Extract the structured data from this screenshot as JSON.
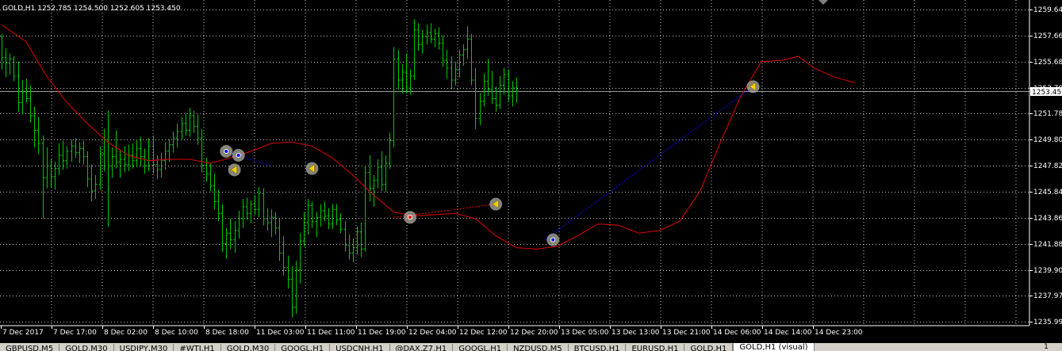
{
  "header": {
    "text": "GOLD,H1  1252.785 1254.500 1252.605 1253.450"
  },
  "current_price_label": "1253.450",
  "price_axis_labels": [
    "1259.645",
    "1257.665",
    "1255.685",
    "1253.705",
    "1251.780",
    "1249.800",
    "1247.820",
    "1245.840",
    "1243.860",
    "1241.880",
    "1239.900",
    "1237.975",
    "1235.995"
  ],
  "time_axis_labels": [
    "7 Dec 2017",
    "7 Dec 17:00",
    "8 Dec 02:00",
    "8 Dec 10:00",
    "8 Dec 18:00",
    "11 Dec 03:00",
    "11 Dec 11:00",
    "11 Dec 19:00",
    "12 Dec 04:00",
    "12 Dec 12:00",
    "12 Dec 20:00",
    "13 Dec 05:00",
    "13 Dec 13:00",
    "13 Dec 21:00",
    "14 Dec 06:00",
    "14 Dec 14:00",
    "14 Dec 23:00"
  ],
  "colors": {
    "bars": "#00c800",
    "ma": "#e00000",
    "grid": "#bfbfbf",
    "trade_buy": "#0000ff",
    "trade_sell": "#ff0000",
    "marker_ring": "#b0b0a0"
  },
  "tabs": [
    "GBPUSD,M5",
    "GOLD,M30",
    "USDJPY,M30",
    "#WTI,H1",
    "GOLD,M30",
    "GOOGL,H1",
    "USDCNH,H1",
    "@DAX.Z7,H1",
    "GOOGL,H1",
    "NZDUSD,M5",
    "BTCUSD,H1",
    "EURUSD,H1",
    "GOLD,H1",
    "GOLD,H1 (visual)"
  ],
  "active_tab": "GOLD,H1 (visual)",
  "tab_nav": "1",
  "chart_data": {
    "type": "bar",
    "style": "ohlc",
    "symbol": "GOLD",
    "timeframe": "H1",
    "ylim": [
      1235.995,
      1259.645
    ],
    "current_price": 1253.45,
    "grid": true,
    "ohlc": [
      [
        1257.6,
        1257.8,
        1255.1,
        1256.0
      ],
      [
        1256.0,
        1256.7,
        1254.5,
        1255.6
      ],
      [
        1255.6,
        1256.3,
        1254.7,
        1255.9
      ],
      [
        1255.9,
        1256.1,
        1254.2,
        1254.6
      ],
      [
        1254.6,
        1255.7,
        1251.9,
        1252.6
      ],
      [
        1252.6,
        1254.3,
        1251.7,
        1253.4
      ],
      [
        1253.4,
        1254.4,
        1252.6,
        1252.9
      ],
      [
        1252.9,
        1253.9,
        1251.1,
        1251.6
      ],
      [
        1251.6,
        1252.3,
        1249.2,
        1250.5
      ],
      [
        1250.5,
        1251.5,
        1248.7,
        1249.5
      ],
      [
        1249.5,
        1250.1,
        1243.8,
        1246.9
      ],
      [
        1246.9,
        1249.2,
        1246.1,
        1247.8
      ],
      [
        1247.8,
        1248.3,
        1246.2,
        1247.0
      ],
      [
        1247.0,
        1248.1,
        1246.0,
        1247.6
      ],
      [
        1247.6,
        1249.5,
        1247.1,
        1248.6
      ],
      [
        1248.6,
        1249.7,
        1247.5,
        1248.2
      ],
      [
        1248.2,
        1249.3,
        1247.6,
        1248.9
      ],
      [
        1248.9,
        1249.8,
        1248.1,
        1249.3
      ],
      [
        1249.3,
        1249.9,
        1248.4,
        1248.8
      ],
      [
        1248.8,
        1249.6,
        1248.0,
        1249.1
      ],
      [
        1249.1,
        1249.7,
        1247.9,
        1248.5
      ],
      [
        1248.5,
        1248.9,
        1246.2,
        1246.8
      ],
      [
        1246.8,
        1247.9,
        1245.1,
        1245.9
      ],
      [
        1245.9,
        1247.1,
        1245.3,
        1246.4
      ],
      [
        1246.4,
        1249.3,
        1246.0,
        1248.7
      ],
      [
        1248.7,
        1250.6,
        1247.4,
        1249.8
      ],
      [
        1249.8,
        1252.0,
        1243.2,
        1247.8
      ],
      [
        1247.8,
        1249.2,
        1246.9,
        1248.5
      ],
      [
        1248.5,
        1250.5,
        1247.6,
        1248.1
      ],
      [
        1248.1,
        1249.0,
        1246.9,
        1248.3
      ],
      [
        1248.3,
        1249.3,
        1247.3,
        1247.9
      ],
      [
        1247.9,
        1249.4,
        1247.4,
        1248.6
      ],
      [
        1248.6,
        1249.5,
        1247.6,
        1248.2
      ],
      [
        1248.2,
        1249.8,
        1247.7,
        1249.1
      ],
      [
        1249.1,
        1250.0,
        1247.8,
        1248.5
      ],
      [
        1248.5,
        1249.1,
        1247.2,
        1247.8
      ],
      [
        1247.8,
        1249.9,
        1247.4,
        1249.3
      ],
      [
        1249.3,
        1250.1,
        1247.2,
        1247.9
      ],
      [
        1247.9,
        1248.6,
        1246.8,
        1247.5
      ],
      [
        1247.5,
        1248.8,
        1246.9,
        1248.2
      ],
      [
        1248.2,
        1249.6,
        1247.5,
        1248.9
      ],
      [
        1248.9,
        1249.8,
        1248.1,
        1249.4
      ],
      [
        1249.4,
        1250.4,
        1248.8,
        1249.9
      ],
      [
        1249.9,
        1251.0,
        1249.2,
        1250.4
      ],
      [
        1250.4,
        1251.5,
        1249.8,
        1251.0
      ],
      [
        1251.0,
        1251.8,
        1250.1,
        1250.5
      ],
      [
        1250.5,
        1252.2,
        1250.0,
        1251.6
      ],
      [
        1251.6,
        1252.0,
        1250.3,
        1250.8
      ],
      [
        1250.8,
        1251.7,
        1249.4,
        1249.9
      ],
      [
        1249.9,
        1250.6,
        1247.3,
        1247.8
      ],
      [
        1247.8,
        1248.4,
        1246.6,
        1247.2
      ],
      [
        1247.2,
        1248.0,
        1245.9,
        1246.3
      ],
      [
        1246.3,
        1247.2,
        1244.5,
        1245.1
      ],
      [
        1245.1,
        1246.0,
        1243.6,
        1244.2
      ],
      [
        1244.2,
        1244.9,
        1241.3,
        1241.9
      ],
      [
        1241.9,
        1243.1,
        1240.8,
        1242.7
      ],
      [
        1242.7,
        1243.8,
        1241.5,
        1242.2
      ],
      [
        1242.2,
        1243.6,
        1241.2,
        1242.9
      ],
      [
        1242.9,
        1244.4,
        1242.3,
        1243.8
      ],
      [
        1243.8,
        1245.3,
        1243.1,
        1244.7
      ],
      [
        1244.7,
        1245.4,
        1243.7,
        1244.2
      ],
      [
        1244.2,
        1245.2,
        1243.5,
        1244.9
      ],
      [
        1244.9,
        1245.6,
        1244.1,
        1244.5
      ],
      [
        1244.5,
        1246.2,
        1243.9,
        1245.7
      ],
      [
        1245.7,
        1246.1,
        1243.3,
        1243.8
      ],
      [
        1243.8,
        1244.6,
        1242.9,
        1243.5
      ],
      [
        1243.5,
        1244.5,
        1242.4,
        1243.9
      ],
      [
        1243.9,
        1244.3,
        1242.6,
        1243.1
      ],
      [
        1243.1,
        1243.8,
        1240.6,
        1241.2
      ],
      [
        1241.2,
        1242.5,
        1239.5,
        1240.1
      ],
      [
        1240.1,
        1241.0,
        1238.5,
        1239.2
      ],
      [
        1239.2,
        1240.2,
        1236.3,
        1237.1
      ],
      [
        1237.1,
        1240.6,
        1236.6,
        1239.9
      ],
      [
        1239.9,
        1242.7,
        1238.9,
        1242.1
      ],
      [
        1242.1,
        1244.3,
        1241.7,
        1243.5
      ],
      [
        1243.5,
        1245.3,
        1242.6,
        1244.8
      ],
      [
        1244.8,
        1245.1,
        1243.1,
        1243.6
      ],
      [
        1243.6,
        1244.3,
        1242.4,
        1243.9
      ],
      [
        1243.9,
        1244.9,
        1243.2,
        1244.4
      ],
      [
        1244.4,
        1245.1,
        1243.6,
        1244.0
      ],
      [
        1244.0,
        1244.6,
        1243.0,
        1243.4
      ],
      [
        1243.4,
        1244.9,
        1243.0,
        1244.5
      ],
      [
        1244.5,
        1244.9,
        1243.3,
        1243.7
      ],
      [
        1243.7,
        1244.2,
        1242.7,
        1243.0
      ],
      [
        1243.0,
        1243.6,
        1241.3,
        1241.8
      ],
      [
        1241.8,
        1242.6,
        1240.7,
        1241.2
      ],
      [
        1241.2,
        1242.3,
        1240.5,
        1241.6
      ],
      [
        1241.6,
        1243.2,
        1241.1,
        1242.8
      ],
      [
        1242.8,
        1243.5,
        1240.9,
        1241.5
      ],
      [
        1241.5,
        1247.8,
        1241.3,
        1247.3
      ],
      [
        1247.3,
        1248.6,
        1245.1,
        1246.1
      ],
      [
        1246.1,
        1247.1,
        1244.7,
        1246.7
      ],
      [
        1246.7,
        1248.3,
        1246.1,
        1247.7
      ],
      [
        1247.7,
        1248.9,
        1245.9,
        1246.4
      ],
      [
        1246.4,
        1248.6,
        1245.8,
        1248.0
      ],
      [
        1248.0,
        1250.3,
        1247.6,
        1249.7
      ],
      [
        1249.7,
        1256.8,
        1249.2,
        1255.9
      ],
      [
        1255.9,
        1256.6,
        1253.6,
        1254.3
      ],
      [
        1254.3,
        1255.5,
        1253.3,
        1254.9
      ],
      [
        1254.9,
        1256.3,
        1253.3,
        1253.7
      ],
      [
        1253.7,
        1255.1,
        1253.2,
        1254.6
      ],
      [
        1254.6,
        1258.9,
        1254.3,
        1258.1
      ],
      [
        1258.1,
        1258.6,
        1256.5,
        1257.0
      ],
      [
        1257.0,
        1258.1,
        1256.3,
        1257.6
      ],
      [
        1257.6,
        1258.5,
        1257.0,
        1257.9
      ],
      [
        1257.9,
        1258.6,
        1257.1,
        1257.4
      ],
      [
        1257.4,
        1258.2,
        1256.8,
        1257.8
      ],
      [
        1257.8,
        1258.3,
        1256.6,
        1257.1
      ],
      [
        1257.1,
        1257.7,
        1255.3,
        1255.8
      ],
      [
        1255.8,
        1256.6,
        1254.4,
        1255.2
      ],
      [
        1255.2,
        1256.1,
        1253.6,
        1254.3
      ],
      [
        1254.3,
        1255.7,
        1253.9,
        1255.1
      ],
      [
        1255.1,
        1256.6,
        1254.5,
        1256.2
      ],
      [
        1256.2,
        1257.0,
        1255.4,
        1256.6
      ],
      [
        1256.6,
        1258.4,
        1255.9,
        1257.4
      ],
      [
        1257.4,
        1257.8,
        1253.9,
        1254.3
      ],
      [
        1254.3,
        1255.2,
        1250.6,
        1251.4
      ],
      [
        1251.4,
        1253.3,
        1250.9,
        1252.7
      ],
      [
        1252.7,
        1254.8,
        1252.3,
        1254.2
      ],
      [
        1254.2,
        1255.9,
        1253.1,
        1253.6
      ],
      [
        1253.6,
        1255.0,
        1252.5,
        1252.9
      ],
      [
        1252.9,
        1253.8,
        1251.9,
        1252.4
      ],
      [
        1252.4,
        1254.6,
        1252.1,
        1253.9
      ],
      [
        1253.9,
        1255.2,
        1253.2,
        1254.7
      ],
      [
        1254.7,
        1255.1,
        1252.7,
        1253.1
      ],
      [
        1253.1,
        1254.2,
        1252.3,
        1253.7
      ],
      [
        1253.7,
        1254.5,
        1252.6,
        1253.45
      ]
    ],
    "ma": [
      [
        0,
        1258.5
      ],
      [
        6,
        1257.2
      ],
      [
        11,
        1254.6
      ],
      [
        16,
        1252.6
      ],
      [
        21,
        1251.0
      ],
      [
        26,
        1249.6
      ],
      [
        31,
        1248.6
      ],
      [
        36,
        1248.2
      ],
      [
        41,
        1248.3
      ],
      [
        46,
        1248.3
      ],
      [
        51,
        1248.0
      ],
      [
        56,
        1248.4
      ],
      [
        61,
        1248.9
      ],
      [
        66,
        1249.5
      ],
      [
        71,
        1249.6
      ],
      [
        76,
        1249.3
      ],
      [
        81,
        1248.4
      ],
      [
        86,
        1247.1
      ],
      [
        91,
        1245.6
      ],
      [
        96,
        1244.3
      ],
      [
        101,
        1244.0
      ],
      [
        106,
        1244.1
      ],
      [
        111,
        1244.2
      ],
      [
        116,
        1243.8
      ],
      [
        121,
        1242.5
      ],
      [
        126,
        1241.6
      ],
      [
        131,
        1241.5
      ],
      [
        136,
        1241.7
      ],
      [
        141,
        1242.5
      ],
      [
        146,
        1243.4
      ],
      [
        151,
        1243.3
      ],
      [
        156,
        1242.7
      ],
      [
        161,
        1242.9
      ],
      [
        166,
        1243.6
      ],
      [
        171,
        1245.9
      ],
      [
        176,
        1249.6
      ],
      [
        181,
        1253.1
      ],
      [
        186,
        1255.7
      ],
      [
        191,
        1255.8
      ],
      [
        195,
        1256.1
      ],
      [
        199,
        1255.2
      ],
      [
        204,
        1254.5
      ],
      [
        209,
        1254.1
      ]
    ],
    "trade_lines": [
      {
        "from": [
          55,
          1248.9
        ],
        "to": [
          66,
          1247.8
        ],
        "color": "blue"
      },
      {
        "from": [
          96,
          1243.9
        ],
        "to": [
          121,
          1244.9
        ],
        "color": "red"
      },
      {
        "from": [
          133,
          1242.2
        ],
        "to": [
          183,
          1253.6
        ],
        "color": "blue"
      }
    ],
    "trade_markers": [
      {
        "i": 55,
        "price": 1248.9,
        "kind": "buy"
      },
      {
        "i": 58,
        "price": 1248.6,
        "kind": "buy"
      },
      {
        "i": 57,
        "price": 1247.5,
        "kind": "close"
      },
      {
        "i": 76,
        "price": 1247.6,
        "kind": "close"
      },
      {
        "i": 100,
        "price": 1243.9,
        "kind": "sell"
      },
      {
        "i": 121,
        "price": 1244.9,
        "kind": "close"
      },
      {
        "i": 135,
        "price": 1242.2,
        "kind": "buy"
      },
      {
        "i": 184,
        "price": 1253.8,
        "kind": "close"
      }
    ]
  }
}
